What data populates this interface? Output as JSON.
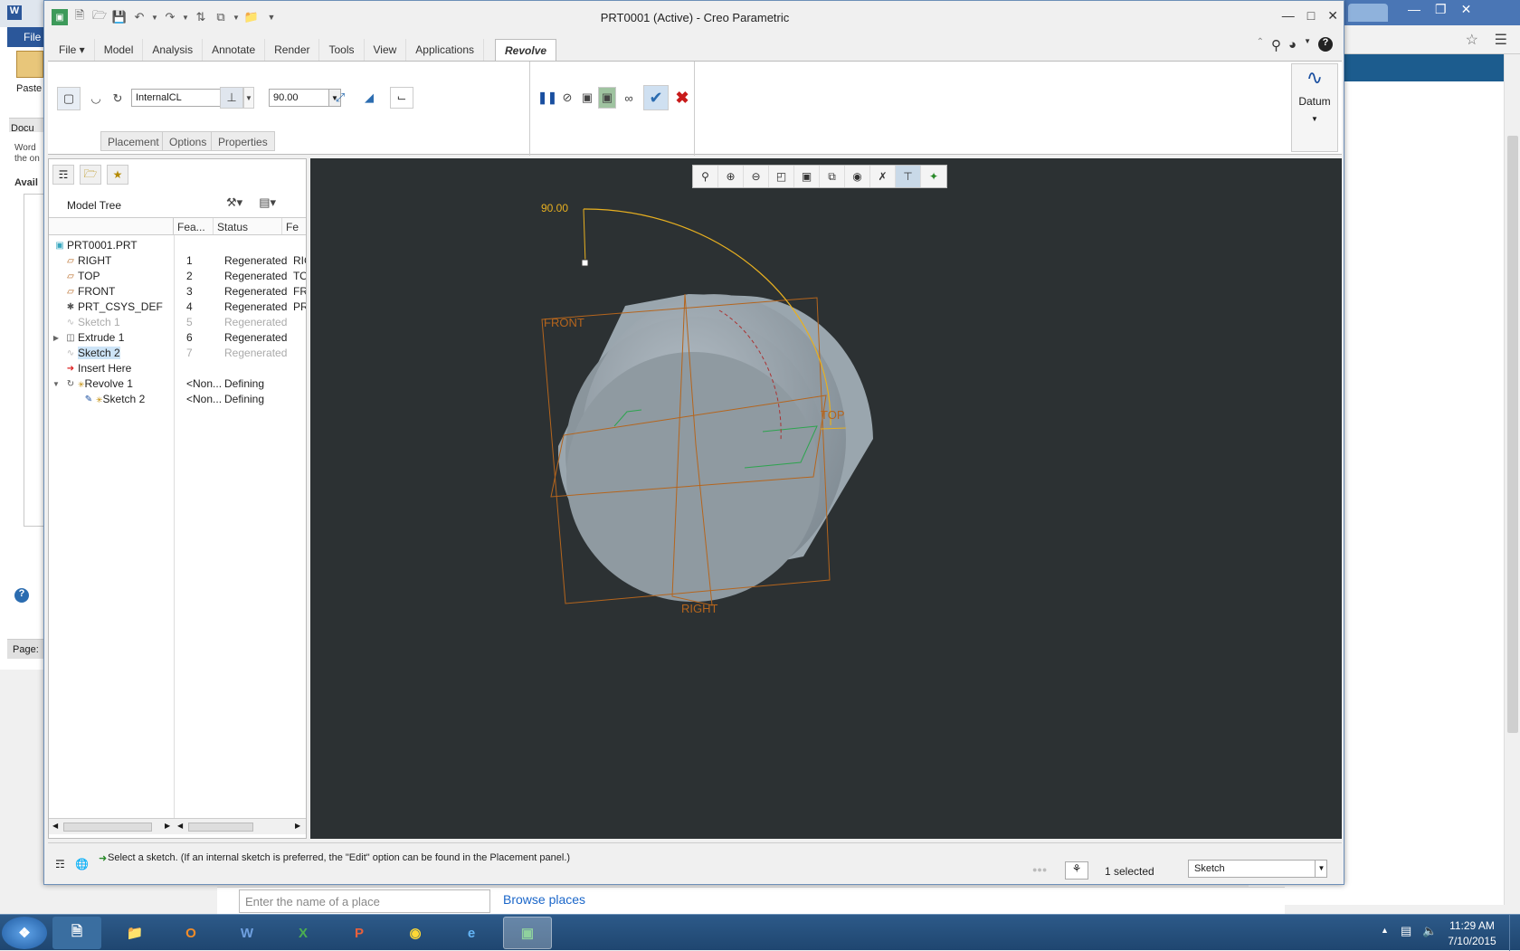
{
  "window": {
    "title": "PRT0001 (Active) - Creo Parametric"
  },
  "background_apps": {
    "word": {
      "file_tab": "File",
      "paste_label": "Paste",
      "doc_label": "Docu",
      "word_hint": "Word",
      "the_on": "the on",
      "avail": "Avail",
      "page": "Page:"
    },
    "maps": {
      "search_placeholder": "Enter the name of a place",
      "browse_link": "Browse places"
    }
  },
  "ribbon": {
    "tabs": [
      "File",
      "Model",
      "Analysis",
      "Annotate",
      "Render",
      "Tools",
      "View",
      "Applications"
    ],
    "active_tab": "Revolve",
    "axis_field": "InternalCL",
    "angle_value": "90.00",
    "subtabs": [
      "Placement",
      "Options",
      "Properties"
    ],
    "datum_label": "Datum"
  },
  "model_tree": {
    "title": "Model Tree",
    "columns": [
      "Fea...",
      "Status",
      "Fe"
    ],
    "rows": [
      {
        "name": "PRT0001.PRT",
        "feat": "",
        "status": "",
        "fe": "",
        "icon": "part-icon",
        "dim": false
      },
      {
        "name": "RIGHT",
        "feat": "1",
        "status": "Regenerated",
        "fe": "RIG",
        "icon": "datum-plane-icon",
        "dim": false
      },
      {
        "name": "TOP",
        "feat": "2",
        "status": "Regenerated",
        "fe": "TO",
        "icon": "datum-plane-icon",
        "dim": false
      },
      {
        "name": "FRONT",
        "feat": "3",
        "status": "Regenerated",
        "fe": "FR",
        "icon": "datum-plane-icon",
        "dim": false
      },
      {
        "name": "PRT_CSYS_DEF",
        "feat": "4",
        "status": "Regenerated",
        "fe": "PR",
        "icon": "csys-icon",
        "dim": false
      },
      {
        "name": "Sketch 1",
        "feat": "5",
        "status": "Regenerated",
        "fe": "",
        "icon": "sketch-icon",
        "dim": true
      },
      {
        "name": "Extrude 1",
        "feat": "6",
        "status": "Regenerated",
        "fe": "",
        "icon": "extrude-icon",
        "dim": false
      },
      {
        "name": "Sketch 2",
        "feat": "7",
        "status": "Regenerated",
        "fe": "",
        "icon": "sketch-icon",
        "dim": true
      },
      {
        "name": "Insert Here",
        "feat": "",
        "status": "",
        "fe": "",
        "icon": "insert-arrow-icon",
        "dim": false
      },
      {
        "name": "Revolve 1",
        "feat": "<Non...",
        "status": "Defining",
        "fe": "",
        "icon": "revolve-icon",
        "dim": false
      },
      {
        "name": "Sketch 2",
        "feat": "<Non...",
        "status": "Defining",
        "fe": "",
        "icon": "sketch-edit-icon",
        "dim": false
      }
    ]
  },
  "graphics": {
    "angle_dimension": "90.00",
    "plane_labels": {
      "front": "FRONT",
      "top": "TOP",
      "right": "RIGHT"
    }
  },
  "status": {
    "message": "Select a sketch. (If an internal sketch is preferred, the \"Edit\" option can be found in the Placement panel.)",
    "selection": "1 selected",
    "filter": "Sketch"
  },
  "taskbar": {
    "time": "11:29 AM",
    "date": "7/10/2015"
  },
  "colors": {
    "accent": "#2b579a",
    "graphics_bg": "#2c3133",
    "datum": "#b5651d",
    "dimension": "#e8b020"
  }
}
